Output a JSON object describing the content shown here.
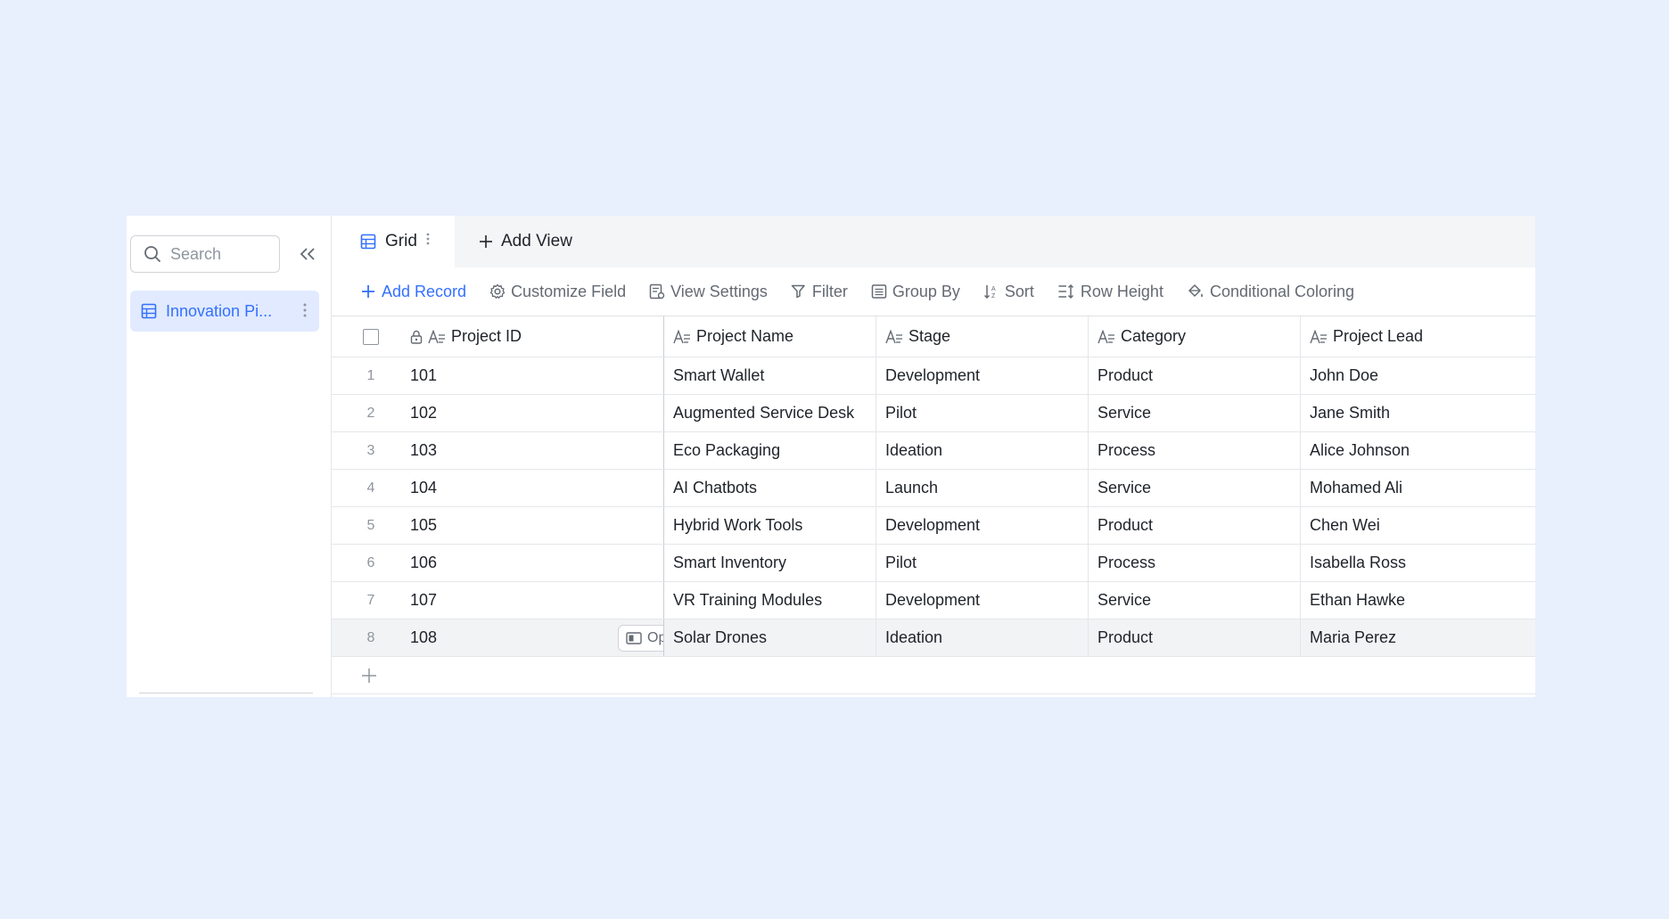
{
  "sidebar": {
    "search_placeholder": "Search",
    "table_name": "Innovation Pi..."
  },
  "tabs": {
    "grid_label": "Grid",
    "add_view_label": "Add View"
  },
  "toolbar": {
    "add_record": "Add Record",
    "customize_field": "Customize Field",
    "view_settings": "View Settings",
    "filter": "Filter",
    "group_by": "Group By",
    "sort": "Sort",
    "row_height": "Row Height",
    "conditional_coloring": "Conditional Coloring"
  },
  "grid": {
    "columns": [
      "Project ID",
      "Project Name",
      "Stage",
      "Category",
      "Project Lead"
    ],
    "open_label": "Open",
    "rows": [
      {
        "idx": "1",
        "id": "101",
        "name": "Smart Wallet",
        "stage": "Development",
        "category": "Product",
        "lead": "John Doe"
      },
      {
        "idx": "2",
        "id": "102",
        "name": "Augmented Service Desk",
        "stage": "Pilot",
        "category": "Service",
        "lead": "Jane Smith"
      },
      {
        "idx": "3",
        "id": "103",
        "name": "Eco Packaging",
        "stage": "Ideation",
        "category": "Process",
        "lead": "Alice Johnson"
      },
      {
        "idx": "4",
        "id": "104",
        "name": "AI Chatbots",
        "stage": "Launch",
        "category": "Service",
        "lead": "Mohamed Ali"
      },
      {
        "idx": "5",
        "id": "105",
        "name": "Hybrid Work Tools",
        "stage": "Development",
        "category": "Product",
        "lead": "Chen Wei"
      },
      {
        "idx": "6",
        "id": "106",
        "name": "Smart Inventory",
        "stage": "Pilot",
        "category": "Process",
        "lead": "Isabella Ross"
      },
      {
        "idx": "7",
        "id": "107",
        "name": "VR Training Modules",
        "stage": "Development",
        "category": "Service",
        "lead": "Ethan Hawke"
      },
      {
        "idx": "8",
        "id": "108",
        "name": "Solar Drones",
        "stage": "Ideation",
        "category": "Product",
        "lead": "Maria Perez"
      }
    ]
  },
  "colors": {
    "background": "#e8effd",
    "accent": "#3370ff",
    "selected_bg": "#e1eaff"
  }
}
